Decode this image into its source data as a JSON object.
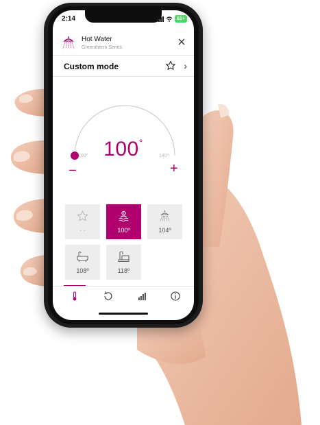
{
  "status": {
    "time": "2:14",
    "battery": "61+"
  },
  "header": {
    "title": "Hot Water",
    "subtitle": "Greentherm Series",
    "icon": "shower-icon",
    "close_icon": "close-icon"
  },
  "mode": {
    "title": "Custom mode",
    "favorite_icon": "star-icon",
    "chevron": "›"
  },
  "dial": {
    "value": "100",
    "degree": "°",
    "min_label": "100°",
    "max_label": "140°",
    "minus": "–",
    "plus": "+",
    "level": 0.0
  },
  "presets": [
    {
      "name": "favorite",
      "icon": "star-icon",
      "label": "- -",
      "active": false
    },
    {
      "name": "hot-water",
      "icon": "hand-wash-icon",
      "label": "100º",
      "active": true
    },
    {
      "name": "shower",
      "icon": "shower-icon",
      "label": "104º",
      "active": false
    },
    {
      "name": "bathtub",
      "icon": "bathtub-icon",
      "label": "108º",
      "active": false
    },
    {
      "name": "kitchen-sink",
      "icon": "sink-icon",
      "label": "118º",
      "active": false
    }
  ],
  "tabs": [
    {
      "name": "temperature",
      "icon": "thermometer-icon",
      "active": true
    },
    {
      "name": "history",
      "icon": "refresh-icon",
      "active": false
    },
    {
      "name": "usage",
      "icon": "bar-chart-icon",
      "active": false
    },
    {
      "name": "info",
      "icon": "info-icon",
      "active": false
    }
  ],
  "colors": {
    "accent": "#b0006e",
    "tile": "#ededed",
    "arc": "#c6c6c6"
  }
}
